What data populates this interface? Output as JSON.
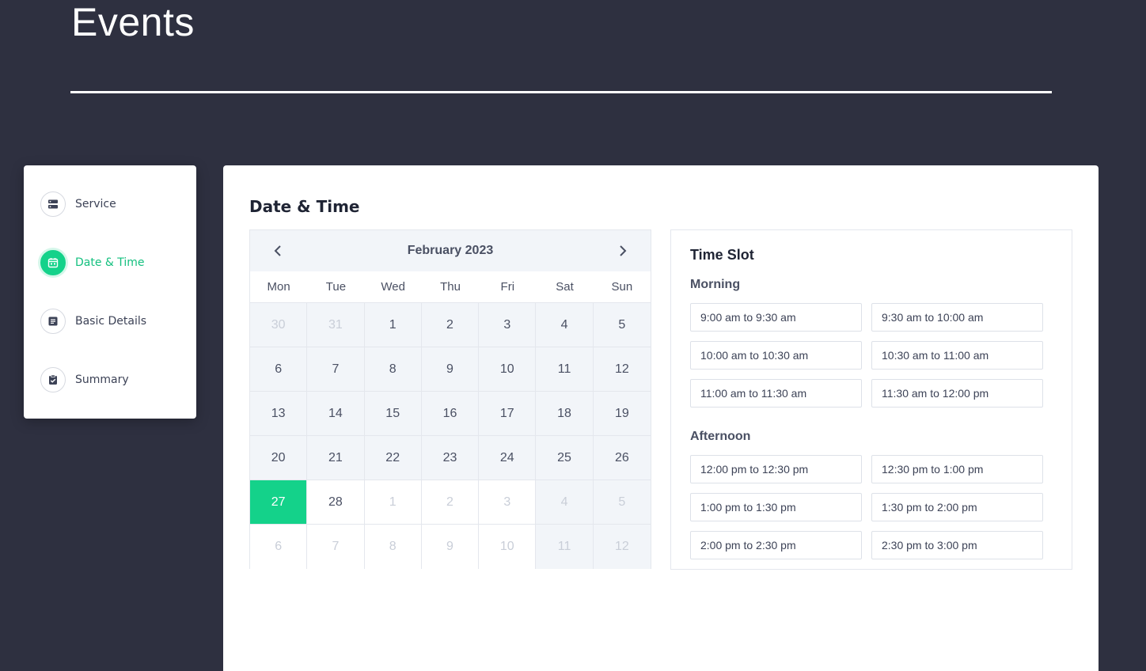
{
  "header": {
    "title": "Events"
  },
  "stepper": {
    "steps": [
      {
        "label": "Service",
        "icon": "server-icon",
        "active": false
      },
      {
        "label": "Date & Time",
        "icon": "calendar-icon",
        "active": true
      },
      {
        "label": "Basic Details",
        "icon": "document-icon",
        "active": false
      },
      {
        "label": "Summary",
        "icon": "clipboard-check-icon",
        "active": false
      }
    ]
  },
  "main": {
    "title": "Date & Time",
    "calendar": {
      "month_label": "February 2023",
      "weekdays": [
        "Mon",
        "Tue",
        "Wed",
        "Thu",
        "Fri",
        "Sat",
        "Sun"
      ],
      "selected_day": "27",
      "days": [
        {
          "n": "30",
          "muted": true
        },
        {
          "n": "31",
          "muted": true
        },
        {
          "n": "1"
        },
        {
          "n": "2"
        },
        {
          "n": "3"
        },
        {
          "n": "4"
        },
        {
          "n": "5"
        },
        {
          "n": "6"
        },
        {
          "n": "7"
        },
        {
          "n": "8"
        },
        {
          "n": "9"
        },
        {
          "n": "10"
        },
        {
          "n": "11"
        },
        {
          "n": "12"
        },
        {
          "n": "13"
        },
        {
          "n": "14"
        },
        {
          "n": "15"
        },
        {
          "n": "16"
        },
        {
          "n": "17"
        },
        {
          "n": "18"
        },
        {
          "n": "19"
        },
        {
          "n": "20"
        },
        {
          "n": "21"
        },
        {
          "n": "22"
        },
        {
          "n": "23"
        },
        {
          "n": "24"
        },
        {
          "n": "25"
        },
        {
          "n": "26"
        },
        {
          "n": "27",
          "selected": true
        },
        {
          "n": "28",
          "white": true
        },
        {
          "n": "1",
          "muted": true,
          "white": true
        },
        {
          "n": "2",
          "muted": true,
          "white": true
        },
        {
          "n": "3",
          "muted": true,
          "white": true
        },
        {
          "n": "4",
          "muted": true
        },
        {
          "n": "5",
          "muted": true
        },
        {
          "n": "6",
          "muted": true,
          "white": true
        },
        {
          "n": "7",
          "muted": true,
          "white": true
        },
        {
          "n": "8",
          "muted": true,
          "white": true
        },
        {
          "n": "9",
          "muted": true,
          "white": true
        },
        {
          "n": "10",
          "muted": true,
          "white": true
        },
        {
          "n": "11",
          "muted": true
        },
        {
          "n": "12",
          "muted": true
        }
      ]
    },
    "time_slot": {
      "title": "Time Slot",
      "morning_label": "Morning",
      "morning": [
        "9:00 am to 9:30 am",
        "9:30 am to 10:00 am",
        "10:00 am to 10:30 am",
        "10:30 am to 11:00 am",
        "11:00 am to 11:30 am",
        "11:30 am to 12:00 pm"
      ],
      "afternoon_label": "Afternoon",
      "afternoon": [
        "12:00 pm to 12:30 pm",
        "12:30 pm to 1:00 pm",
        "1:00 pm to 1:30 pm",
        "1:30 pm to 2:00 pm",
        "2:00 pm to 2:30 pm",
        "2:30 pm to 3:00 pm"
      ]
    }
  },
  "colors": {
    "background": "#2e3040",
    "accent": "#14d28a",
    "calendar_cell": "#f2f5f9",
    "text": "#4a5063"
  }
}
